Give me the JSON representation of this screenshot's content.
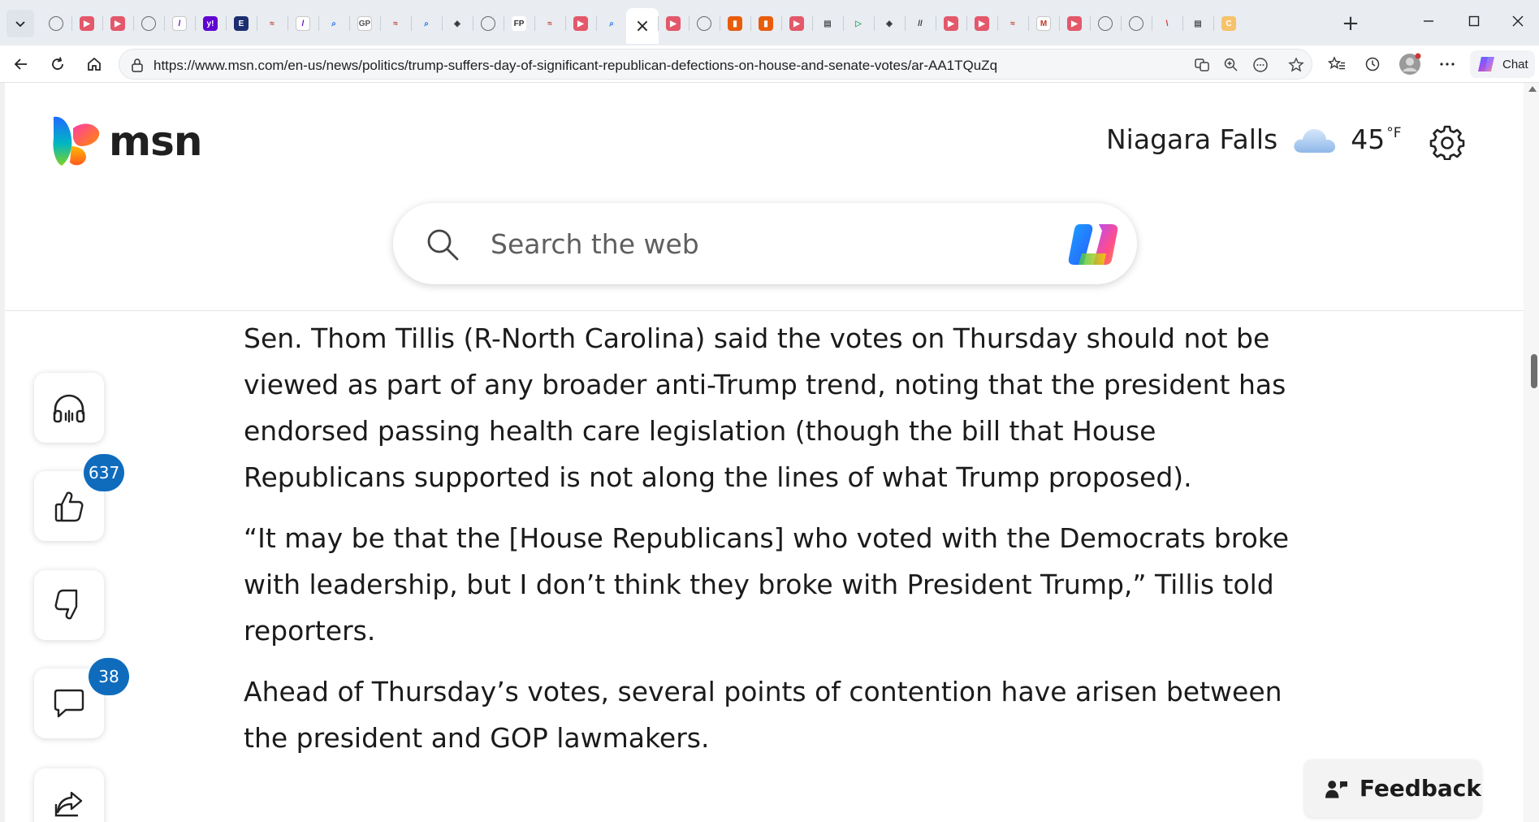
{
  "browser": {
    "url": "https://www.msn.com/en-us/news/politics/trump-suffers-day-of-significant-republican-defections-on-house-and-senate-votes/ar-AA1TQuZq",
    "chat_label": "Chat",
    "new_tab_glyph": "+",
    "close_tab_glyph": "×",
    "tabs": [
      {
        "icon": "globe-icon"
      },
      {
        "icon": "youtube-icon"
      },
      {
        "icon": "youtube-icon"
      },
      {
        "icon": "globe-icon"
      },
      {
        "icon": "yahoo-slash-icon"
      },
      {
        "icon": "yahoo-icon"
      },
      {
        "icon": "e-news-icon"
      },
      {
        "icon": "wave-icon"
      },
      {
        "icon": "yahoo-slash-icon"
      },
      {
        "icon": "search-icon"
      },
      {
        "icon": "gp-icon"
      },
      {
        "icon": "wave-icon"
      },
      {
        "icon": "search-icon"
      },
      {
        "icon": "diamond-icon"
      },
      {
        "icon": "globe-icon"
      },
      {
        "icon": "fp-icon"
      },
      {
        "icon": "wave-icon"
      },
      {
        "icon": "youtube-icon"
      },
      {
        "icon": "search-icon"
      },
      {
        "icon": "close-icon",
        "active": true
      },
      {
        "icon": "youtube-icon"
      },
      {
        "icon": "globe-icon"
      },
      {
        "icon": "bookmark-icon"
      },
      {
        "icon": "bookmark-icon"
      },
      {
        "icon": "youtube-icon"
      },
      {
        "icon": "document-icon"
      },
      {
        "icon": "play-icon"
      },
      {
        "icon": "diamond-icon"
      },
      {
        "icon": "nm-icon"
      },
      {
        "icon": "youtube-icon"
      },
      {
        "icon": "youtube-icon"
      },
      {
        "icon": "wave-icon"
      },
      {
        "icon": "m-icon"
      },
      {
        "icon": "youtube-icon"
      },
      {
        "icon": "globe-icon"
      },
      {
        "icon": "globe-icon"
      },
      {
        "icon": "slash-icon"
      },
      {
        "icon": "document-icon"
      },
      {
        "icon": "orange-icon"
      }
    ],
    "favicon_labels": {
      "gp": "GP",
      "fp": "FP",
      "e": "E",
      "y": "y!",
      "m": "M"
    }
  },
  "header": {
    "logo_text": "msn",
    "weather": {
      "city": "Niagara Falls",
      "temp": "45",
      "unit": "°F"
    }
  },
  "search": {
    "placeholder": "Search the web"
  },
  "article": {
    "paragraphs": [
      "Sen. Thom Tillis (R-North Carolina) said the votes on Thursday should not be viewed as part of any broader anti-Trump trend, noting that the president has endorsed passing health care legislation (though the bill that House Republicans supported is not along the lines of what Trump proposed).",
      "“It may be that the [House Republicans] who voted with the Democrats broke with leadership, but I don’t think they broke with President Trump,” Tillis told reporters.",
      "Ahead of Thursday’s votes, several points of contention have arisen between the president and GOP lawmakers."
    ]
  },
  "rail": {
    "likes": "637",
    "comments": "38"
  },
  "feedback": {
    "label": "Feedback"
  },
  "colors": {
    "accent": "#0f6cbd",
    "tabstrip": "#e9ecf1"
  }
}
